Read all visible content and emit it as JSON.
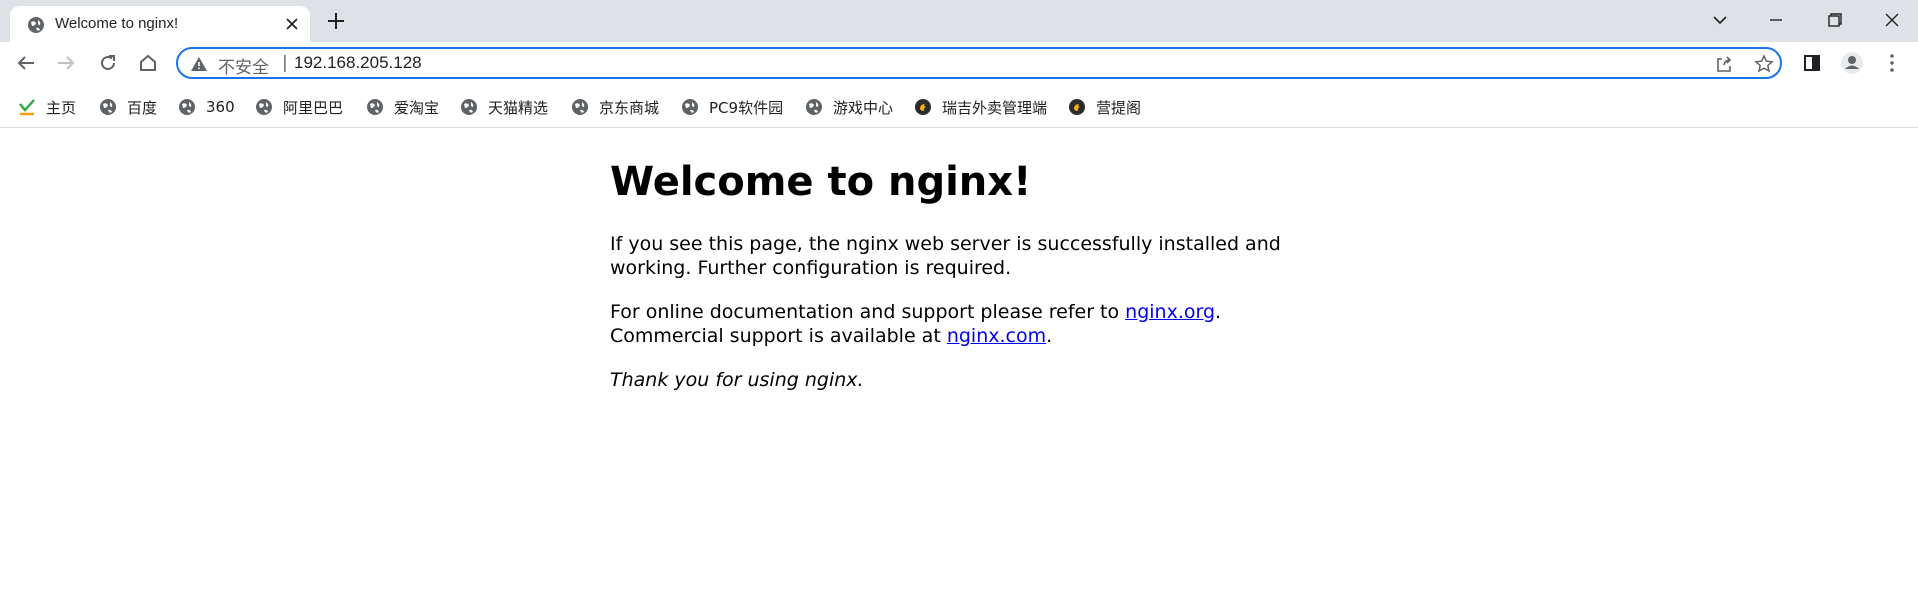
{
  "browser": {
    "tab": {
      "title": "Welcome to nginx!",
      "favicon": "globe-icon"
    },
    "address_bar": {
      "security_label": "不安全",
      "separator": "|",
      "url": "192.168.205.128"
    },
    "bookmarks": [
      {
        "label": "主页",
        "icon": "hao-icon"
      },
      {
        "label": "百度",
        "icon": "globe-icon"
      },
      {
        "label": "360",
        "icon": "globe-icon"
      },
      {
        "label": "阿里巴巴",
        "icon": "globe-icon"
      },
      {
        "label": "爱淘宝",
        "icon": "globe-icon"
      },
      {
        "label": "天猫精选",
        "icon": "globe-icon"
      },
      {
        "label": "京东商城",
        "icon": "globe-icon"
      },
      {
        "label": "PC9软件园",
        "icon": "globe-icon"
      },
      {
        "label": "游戏中心",
        "icon": "globe-icon"
      },
      {
        "label": "瑞吉外卖管理端",
        "icon": "app-icon"
      },
      {
        "label": "营提阁",
        "icon": "app-icon"
      }
    ],
    "colors": {
      "accent": "#1a73e8",
      "tabstrip": "#dee1e6",
      "link": "#0000ee"
    }
  },
  "page": {
    "heading": "Welcome to nginx!",
    "p1": "If you see this page, the nginx web server is successfully installed and working. Further configuration is required.",
    "p2_prefix": "For online documentation and support please refer to ",
    "p2_link1": "nginx.org",
    "p2_mid": ".",
    "p2_line2": "Commercial support is available at ",
    "p2_link2": "nginx.com",
    "p2_end": ".",
    "p3": "Thank you for using nginx."
  }
}
